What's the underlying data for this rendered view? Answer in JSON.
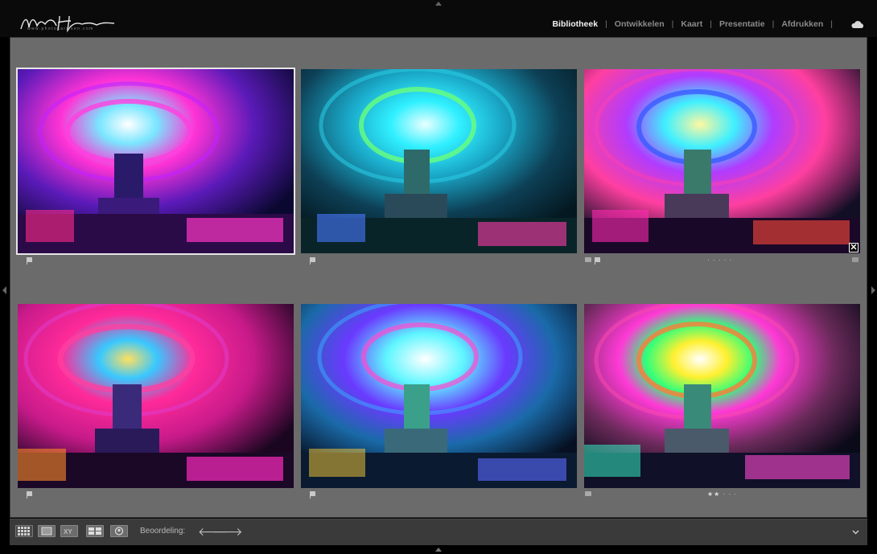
{
  "identity_plate": {
    "signature": "Nando Harmsen",
    "website": "www.photoharmsen.com"
  },
  "modules": [
    {
      "label": "Bibliotheek",
      "active": true
    },
    {
      "label": "Ontwikkelen",
      "active": false
    },
    {
      "label": "Kaart",
      "active": false
    },
    {
      "label": "Presentatie",
      "active": false
    },
    {
      "label": "Afdrukken",
      "active": false
    }
  ],
  "module_separator": "|",
  "cloud_icon": "cloud-icon",
  "thumbnails": [
    {
      "id": 1,
      "selected": true,
      "palette": "magenta-blue",
      "rating": "",
      "flag": true
    },
    {
      "id": 2,
      "selected": false,
      "palette": "cyan-teal",
      "rating": "",
      "flag": true
    },
    {
      "id": 3,
      "selected": false,
      "palette": "blue-pink",
      "rating": "· · · · ·",
      "flag": true,
      "reject_badge": "✕"
    },
    {
      "id": 4,
      "selected": false,
      "palette": "pink-magenta",
      "rating": "",
      "flag": true
    },
    {
      "id": 5,
      "selected": false,
      "palette": "cyan-white",
      "rating": "",
      "flag": true
    },
    {
      "id": 6,
      "selected": false,
      "palette": "rainbow",
      "rating": "★★ · · ·",
      "flag": true
    }
  ],
  "toolbar": {
    "view_buttons": [
      "grid-view",
      "loupe-view",
      "compare-view",
      "survey-view",
      "people-view"
    ],
    "rating_label": "Beoordeling:",
    "prev_arrow": "🡐",
    "next_arrow": "🡒"
  },
  "colors": {
    "grid_background": "#6b6b6b",
    "active_module": "#f2f2f2",
    "inactive_module": "#8a8a8a"
  }
}
